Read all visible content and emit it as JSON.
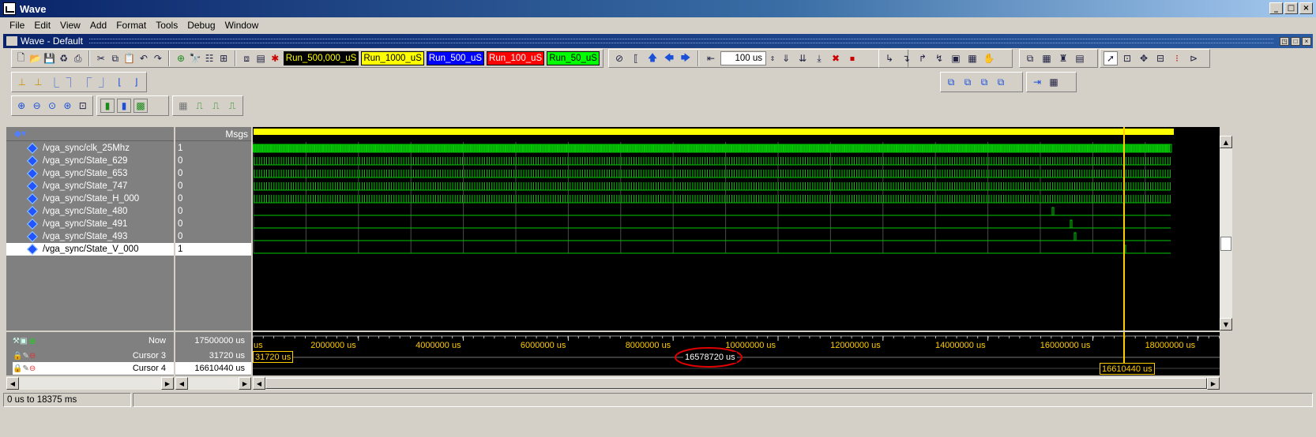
{
  "window": {
    "title": "Wave"
  },
  "menu": [
    "File",
    "Edit",
    "View",
    "Add",
    "Format",
    "Tools",
    "Debug",
    "Window"
  ],
  "subwindow": {
    "title": "Wave - Default"
  },
  "run_buttons": [
    {
      "label": "Run_500,000_uS",
      "bg": "#ffff00",
      "fg": "#000000",
      "border": "#000000",
      "bgk": "#000000",
      "inv": true
    },
    {
      "label": "Run_1000_uS",
      "bg": "#ffff00",
      "fg": "#000000"
    },
    {
      "label": "Run_500_uS",
      "bg": "#0000ff",
      "fg": "#ffffff"
    },
    {
      "label": "Run_100_uS",
      "bg": "#ff0000",
      "fg": "#ffffff"
    },
    {
      "label": "Run_50_uS",
      "bg": "#00ff00",
      "fg": "#000000"
    }
  ],
  "run_length": {
    "value": "100 us"
  },
  "wave_header": {
    "msgs_label": "Msgs"
  },
  "signals": [
    {
      "name": "/vga_sync/clk_25Mhz",
      "value": "1"
    },
    {
      "name": "/vga_sync/State_629",
      "value": "0"
    },
    {
      "name": "/vga_sync/State_653",
      "value": "0"
    },
    {
      "name": "/vga_sync/State_747",
      "value": "0"
    },
    {
      "name": "/vga_sync/State_H_000",
      "value": "0"
    },
    {
      "name": "/vga_sync/State_480",
      "value": "0"
    },
    {
      "name": "/vga_sync/State_491",
      "value": "0"
    },
    {
      "name": "/vga_sync/State_493",
      "value": "0"
    },
    {
      "name": "/vga_sync/State_V_000",
      "value": "1"
    }
  ],
  "cursors": {
    "now_label": "Now",
    "now_value": "17500000 us",
    "cursor3_label": "Cursor 3",
    "cursor3_value": "31720 us",
    "cursor4_label": "Cursor 4",
    "cursor4_value": "16610440 us",
    "cursor3_marker": "31720 us",
    "delta": "16578720 us",
    "cursor4_marker": "16610440 us"
  },
  "timeline": {
    "start_label": "us",
    "ticks": [
      "2000000 us",
      "4000000 us",
      "6000000 us",
      "8000000 us",
      "10000000 us",
      "12000000 us",
      "14000000 us",
      "16000000 us",
      "18000000 us"
    ]
  },
  "status": {
    "range": "0 us to 18375 ms"
  },
  "colors": {
    "wave": "#00c800",
    "cursor": "#ffcc00",
    "annotation": "#e00000"
  }
}
